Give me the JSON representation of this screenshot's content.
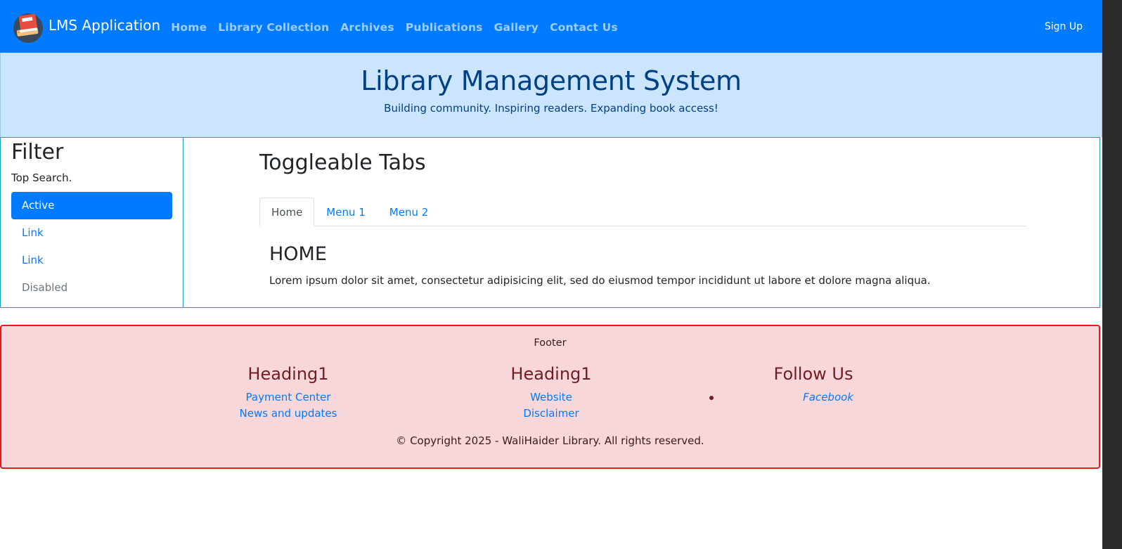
{
  "navbar": {
    "brand": "LMS Application",
    "links": [
      "Home",
      "Library Collection",
      "Archives",
      "Publications",
      "Gallery",
      "Contact Us"
    ],
    "signup": "Sign Up",
    "logo_icon": "book-stack-icon",
    "color": "#007bff"
  },
  "hero": {
    "title": "Library Management System",
    "subtitle": "Building community. Inspiring readers. Expanding book access!"
  },
  "sidebar": {
    "title": "Filter",
    "subtitle": "Top Search.",
    "items": [
      {
        "label": "Active",
        "state": "active"
      },
      {
        "label": "Link",
        "state": "normal"
      },
      {
        "label": "Link",
        "state": "normal"
      },
      {
        "label": "Disabled",
        "state": "disabled"
      }
    ]
  },
  "main": {
    "title": "Toggleable Tabs",
    "tabs": [
      {
        "label": "Home",
        "active": true
      },
      {
        "label": "Menu 1",
        "active": false
      },
      {
        "label": "Menu 2",
        "active": false
      }
    ],
    "pane": {
      "title": "HOME",
      "text": "Lorem ipsum dolor sit amet, consectetur adipisicing elit, sed do eiusmod tempor incididunt ut labore et dolore magna aliqua."
    }
  },
  "footer": {
    "label": "Footer",
    "columns": [
      {
        "heading": "Heading1",
        "links": [
          "Payment Center",
          "News and updates"
        ]
      },
      {
        "heading": "Heading1",
        "links": [
          "Website",
          "Disclaimer"
        ]
      },
      {
        "heading": "Follow Us",
        "links": [
          "Facebook"
        ]
      }
    ],
    "copyright": "© Copyright 2025 - WaliHaider Library. All rights reserved."
  }
}
